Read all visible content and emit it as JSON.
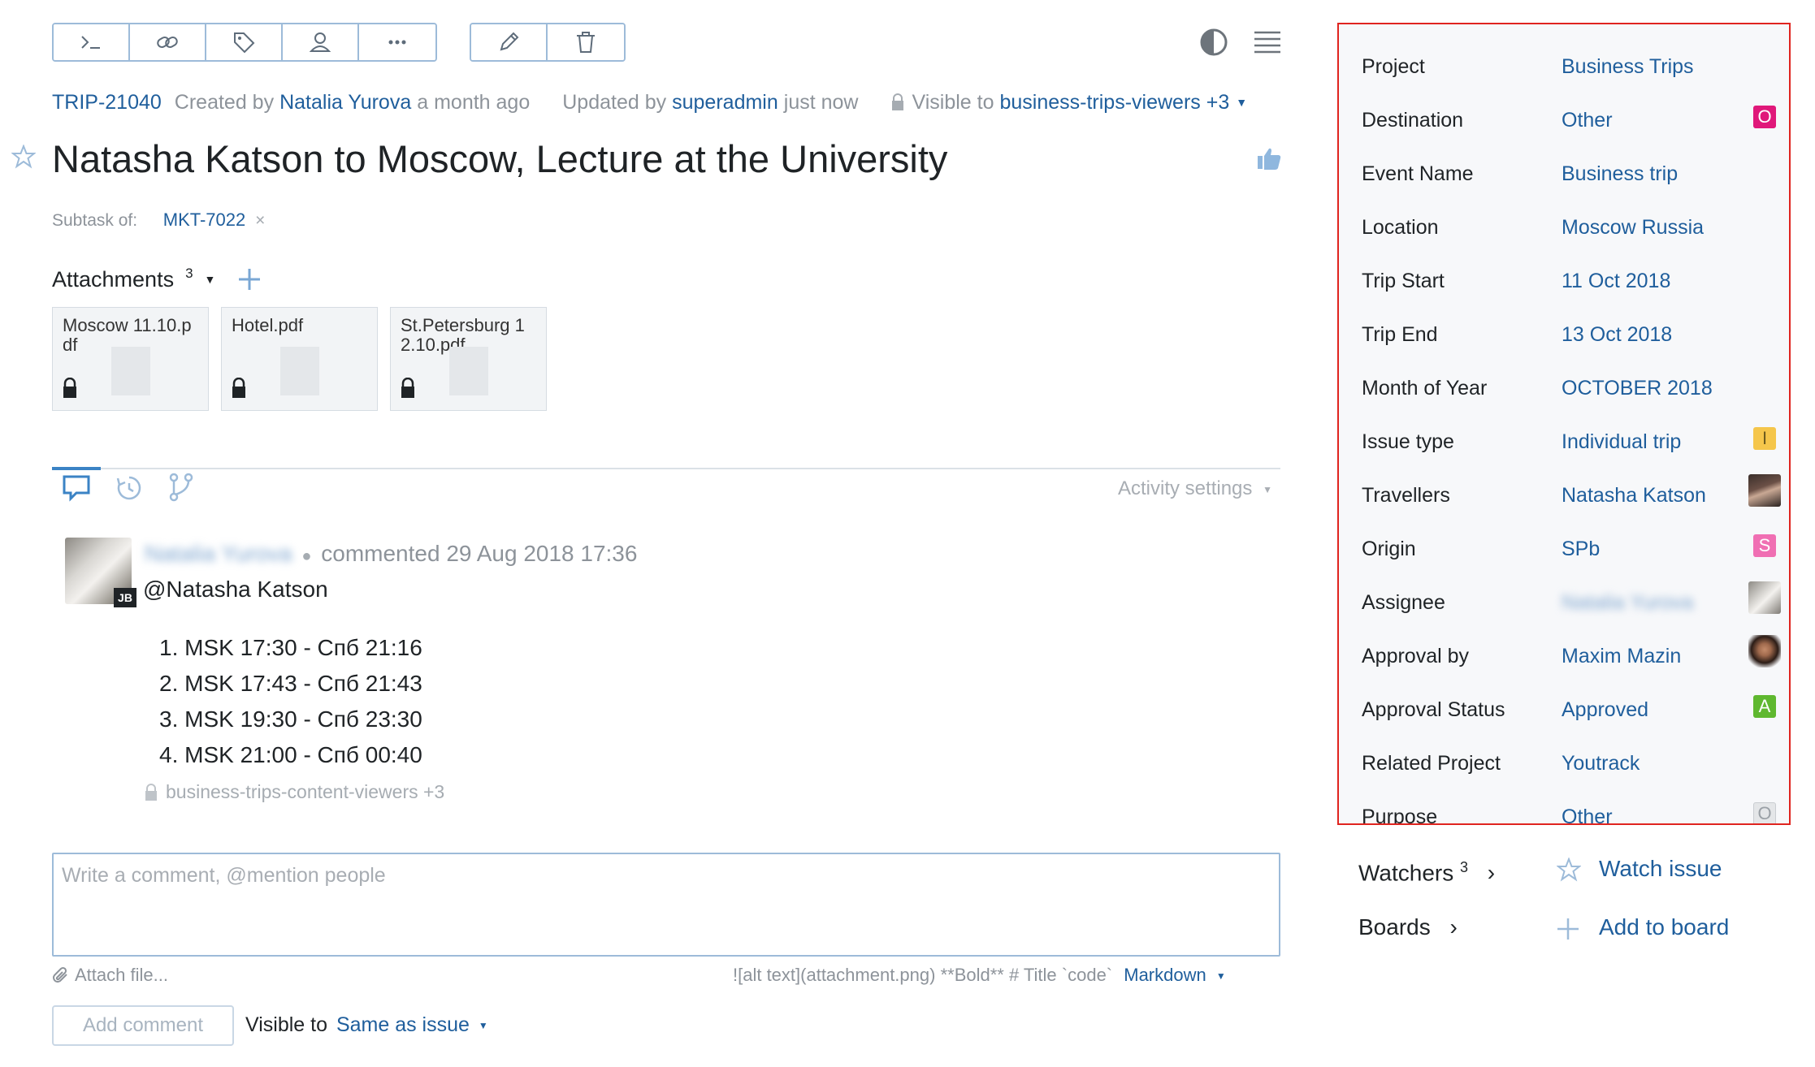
{
  "toolbar": {
    "group1": [
      "command-icon",
      "link-icon",
      "tag-icon",
      "user-icon",
      "more-icon"
    ],
    "group2": [
      "edit-icon",
      "delete-icon"
    ]
  },
  "meta": {
    "issue_id": "TRIP-21040",
    "created_prefix": "Created by",
    "created_by": "Natalia Yurova",
    "created_when": "a month ago",
    "updated_prefix": "Updated by",
    "updated_by": "superadmin",
    "updated_when": "just now",
    "visible_prefix": "Visible to",
    "visible_group": "business-trips-viewers +3"
  },
  "issue": {
    "title": "Natasha Katson to Moscow, Lecture at the University",
    "subtask_label": "Subtask of:",
    "subtask_id": "MKT-7022"
  },
  "attachments": {
    "label": "Attachments",
    "count": "3",
    "files": [
      {
        "name": "Moscow 11.10.pdf"
      },
      {
        "name": "Hotel.pdf"
      },
      {
        "name": "St.Petersburg 12.10.pdf"
      }
    ]
  },
  "activity": {
    "settings_label": "Activity settings"
  },
  "comment": {
    "author_blurred": "Natalia Yurova",
    "action": "commented 29 Aug 2018 17:36",
    "mention": "@Natasha Katson",
    "items": [
      "MSK 17:30 - Спб 21:16",
      "MSK 17:43 - Спб 21:43",
      "MSK 19:30 - Спб 23:30",
      "MSK 21:00 - Спб 00:40"
    ],
    "visibility": "business-trips-content-viewers +3",
    "avatar_badge": "JB"
  },
  "new_comment": {
    "placeholder": "Write a comment, @mention people",
    "attach_label": "Attach file...",
    "markdown_hint": "![alt text](attachment.png) **Bold** # Title `code`",
    "markdown_label": "Markdown",
    "add_button": "Add comment",
    "visible_prefix": "Visible to",
    "visible_value": "Same as issue"
  },
  "fields": [
    {
      "label": "Project",
      "value": "Business Trips"
    },
    {
      "label": "Destination",
      "value": "Other",
      "badge": "O",
      "badge_color": "#e0187a"
    },
    {
      "label": "Event Name",
      "value": "Business trip"
    },
    {
      "label": "Location",
      "value": "Moscow Russia"
    },
    {
      "label": "Trip Start",
      "value": "11 Oct 2018"
    },
    {
      "label": "Trip End",
      "value": "13 Oct 2018"
    },
    {
      "label": "Month of Year",
      "value": "OCTOBER 2018"
    },
    {
      "label": "Issue type",
      "value": "Individual trip",
      "badge": "I",
      "badge_color": "#f5c64b"
    },
    {
      "label": "Travellers",
      "value": "Natasha Katson",
      "avatar": true
    },
    {
      "label": "Origin",
      "value": "SPb",
      "badge": "S",
      "badge_color": "#f06fb3"
    },
    {
      "label": "Assignee",
      "value": "Natalia Yurova",
      "blurred": true,
      "avatar": true
    },
    {
      "label": "Approval by",
      "value": "Maxim Mazin",
      "avatar": true
    },
    {
      "label": "Approval Status",
      "value": "Approved",
      "badge": "A",
      "badge_color": "#5fb82f"
    },
    {
      "label": "Related Project",
      "value": "Youtrack"
    },
    {
      "label": "Purpose",
      "value": "Other",
      "badge": "O",
      "badge_color": "#c9cdd1"
    }
  ],
  "watchers": {
    "label": "Watchers",
    "count": "3",
    "action": "Watch issue"
  },
  "boards": {
    "label": "Boards",
    "action": "Add to board"
  }
}
